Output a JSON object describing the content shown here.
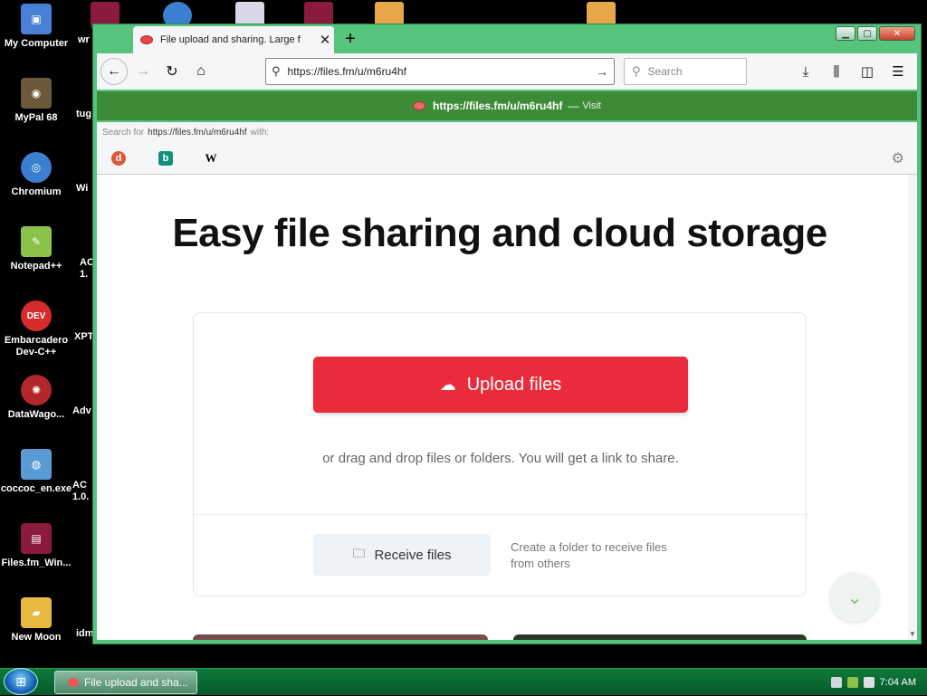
{
  "desktop": {
    "icons": [
      {
        "label": "My Computer",
        "glyph": "▣",
        "color": "#4a7fd6"
      },
      {
        "label": "MyPal 68",
        "glyph": "◉",
        "color": "#6b5a3a"
      },
      {
        "label": "Chromium",
        "glyph": "◎",
        "color": "#3b7fd0"
      },
      {
        "label": "Notepad++",
        "glyph": "✎",
        "color": "#8bc34a"
      },
      {
        "label": "Embarcadero Dev-C++",
        "glyph": "DEV",
        "color": "#d62b2b"
      },
      {
        "label": "DataWago...",
        "glyph": "✺",
        "color": "#b3262b"
      },
      {
        "label": "coccoc_en.exe",
        "glyph": "◍",
        "color": "#5b9bd5"
      },
      {
        "label": "Files.fm_Win...",
        "glyph": "▤",
        "color": "#8b1b3c"
      },
      {
        "label": "New Moon",
        "glyph": "▰",
        "color": "#e7b93e"
      }
    ],
    "partial_labels": [
      "wr",
      "tug",
      "Wi",
      "AC 1.",
      "XPT",
      "Adv",
      "AC 1.0.",
      "idm"
    ]
  },
  "browser": {
    "tab_title": "File upload and sharing. Large f",
    "url": "https://files.fm/u/m6ru4hf",
    "search_placeholder": "Search",
    "autocomplete": {
      "url": "https://files.fm/u/m6ru4hf",
      "separator": "—",
      "action": "Visit"
    },
    "search_for": {
      "prefix": "Search for",
      "query": "https://files.fm/u/m6ru4hf",
      "suffix": "with:"
    },
    "engines": [
      "DuckDuckGo",
      "Bing",
      "Wikipedia"
    ]
  },
  "page": {
    "headline": "Easy file sharing and cloud storage",
    "upload_label": "Upload files",
    "drag_text": "or drag and drop files or folders. You will get a link to share.",
    "receive_label": "Receive files",
    "receive_desc": "Create a folder to receive files from others"
  },
  "taskbar": {
    "task_label": "File upload and sha...",
    "time": "7:04 AM"
  },
  "colors": {
    "accent_red": "#ea2b3c",
    "window_green": "#57c47d",
    "autocomplete_green": "#3d8b37"
  }
}
